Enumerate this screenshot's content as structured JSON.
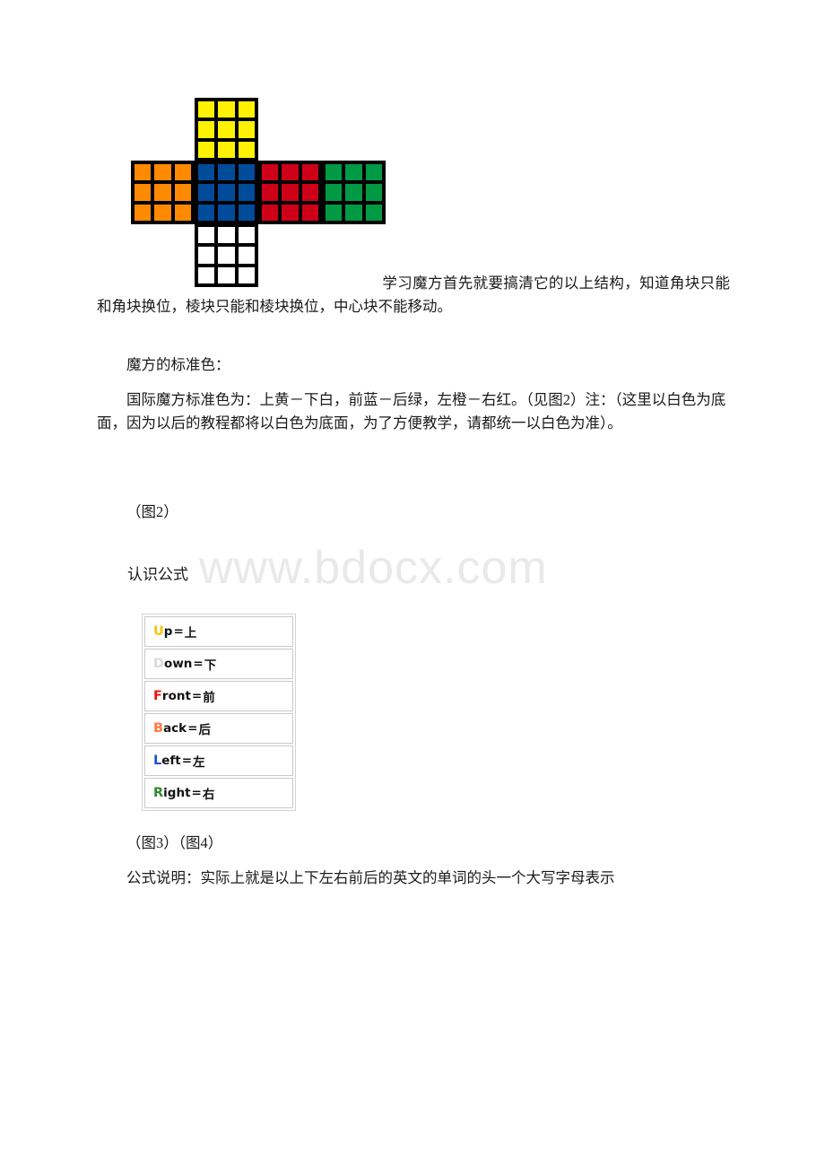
{
  "document": {
    "watermark": "www.bdocx.com"
  },
  "figure2": {
    "caption": "（图2）",
    "alt_name": "rubiks-cube-unfolded-net",
    "colors": {
      "up": "#FFF200",
      "down": "#FFFFFF",
      "front": "#004C9B",
      "back": "#009944",
      "left": "#FF8A00",
      "right": "#CE0018",
      "grid_line": "#000000"
    },
    "faces": [
      {
        "name": "up",
        "label": "上",
        "color": "#FFF200",
        "cells": 9
      },
      {
        "name": "left",
        "label": "左",
        "color": "#FF8A00",
        "cells": 9
      },
      {
        "name": "front",
        "label": "前",
        "color": "#004C9B",
        "cells": 9
      },
      {
        "name": "right",
        "label": "右",
        "color": "#CE0018",
        "cells": 9
      },
      {
        "name": "back",
        "label": "后",
        "color": "#009944",
        "cells": 9
      },
      {
        "name": "down",
        "label": "下",
        "color": "#FFFFFF",
        "cells": 9
      }
    ]
  },
  "paragraphs": {
    "structure": "学习魔方首先就要搞清它的以上结构，知道角块只能和角块换位，棱块只能和棱块换位，中心块不能移动。",
    "standard_color_title": "魔方的标准色：",
    "standard_color_body": "国际魔方标准色为：上黄－下白，前蓝－后绿，左橙－右红。（见图2）注：（这里以白色为底面，因为以后的教程都将以白色为底面，为了方便教学，请都统一以白色为准）。",
    "recognize_formula_title": "认识公式",
    "figure34_caption": "（图3）（图4）",
    "formula_note": "公式说明：实际上就是以上下左右前后的英文的单词的头一个大写字母表示"
  },
  "formula_table": {
    "rows": [
      {
        "initial": "U",
        "rest": "p",
        "equals": "=",
        "cn": "上",
        "color": "#F5C400"
      },
      {
        "initial": "D",
        "rest": "own",
        "equals": "=",
        "cn": "下",
        "color": "#D9D9D9"
      },
      {
        "initial": "F",
        "rest": "ront",
        "equals": "=",
        "cn": "前",
        "color": "#E8160C"
      },
      {
        "initial": "B",
        "rest": "ack",
        "equals": "=",
        "cn": "后",
        "color": "#FF7744"
      },
      {
        "initial": "L",
        "rest": "eft",
        "equals": "=",
        "cn": "左",
        "color": "#1B4FD8"
      },
      {
        "initial": "R",
        "rest": "ight",
        "equals": "=",
        "cn": "右",
        "color": "#2E8B2E"
      }
    ]
  }
}
